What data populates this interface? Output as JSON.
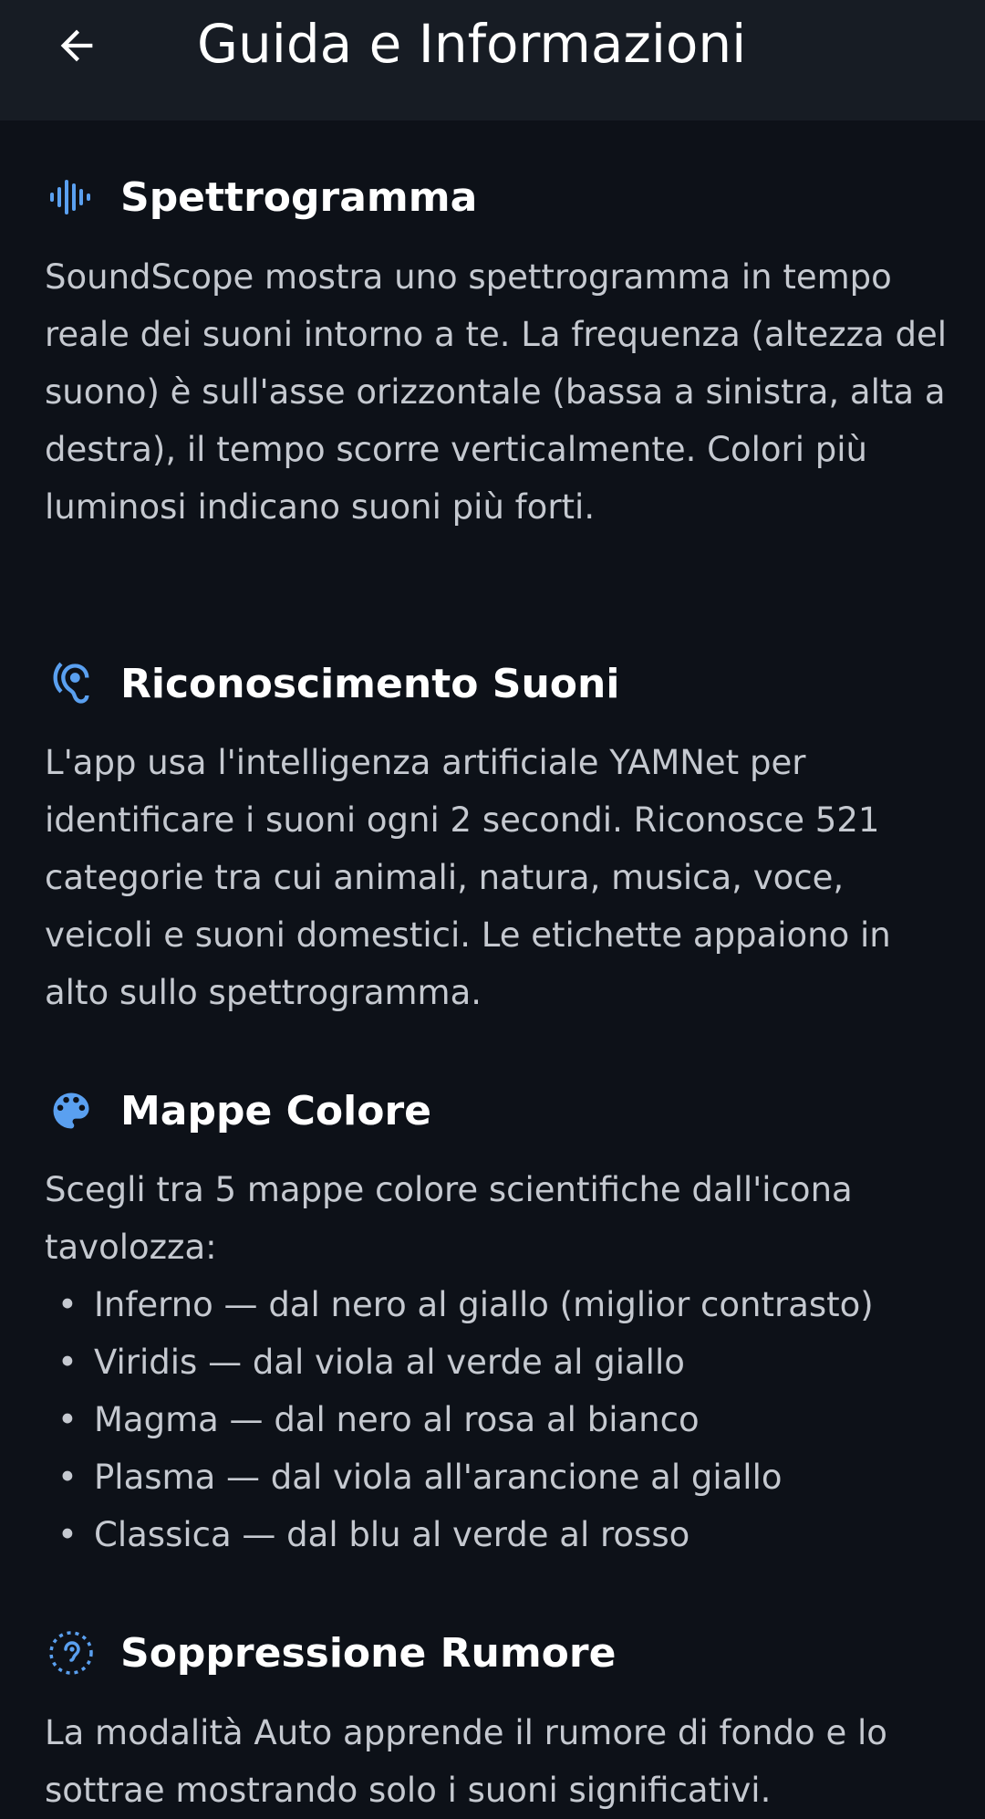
{
  "header": {
    "title": "Guida e Informazioni",
    "back_icon": "arrow-left-icon"
  },
  "sections": [
    {
      "icon": "waveform-icon",
      "title": "Spettrogramma",
      "body": "SoundScope mostra uno spettrogramma in tempo reale dei suoni intorno a te. La frequenza (altezza del suono) è sull'asse orizzontale (bassa a sinistra, alta a destra), il tempo scorre verticalmente. Colori più luminosi indicano suoni più forti."
    },
    {
      "icon": "hearing-icon",
      "title": "Riconoscimento Suoni",
      "body": "L'app usa l'intelligenza artificiale YAMNet per identificare i suoni ogni 2 secondi. Riconosce 521 categorie tra cui animali, natura, musica, voce, veicoli e suoni domestici. Le etichette appaiono in alto sullo spettrogramma."
    },
    {
      "icon": "palette-icon",
      "title": "Mappe Colore",
      "intro": "Scegli tra 5 mappe colore scientifiche dall'icona tavolozza:",
      "bullet_char": "•",
      "bullets": [
        "Inferno — dal nero al giallo (miglior contrasto)",
        "Viridis — dal viola al verde al giallo",
        "Magma — dal nero al rosa al bianco",
        "Plasma — dal viola all'arancione al giallo",
        "Classica — dal blu al verde al rosso"
      ]
    },
    {
      "icon": "hearing-disabled-icon",
      "title": "Soppressione Rumore",
      "body": "La modalità Auto apprende il rumore di fondo e lo sottrae mostrando solo i suoni significativi."
    }
  ],
  "colors": {
    "background": "#0d1118",
    "topbar": "#171c24",
    "accent": "#5aa0f0",
    "title_text": "#ffffff",
    "body_text": "#c5c9d0"
  }
}
